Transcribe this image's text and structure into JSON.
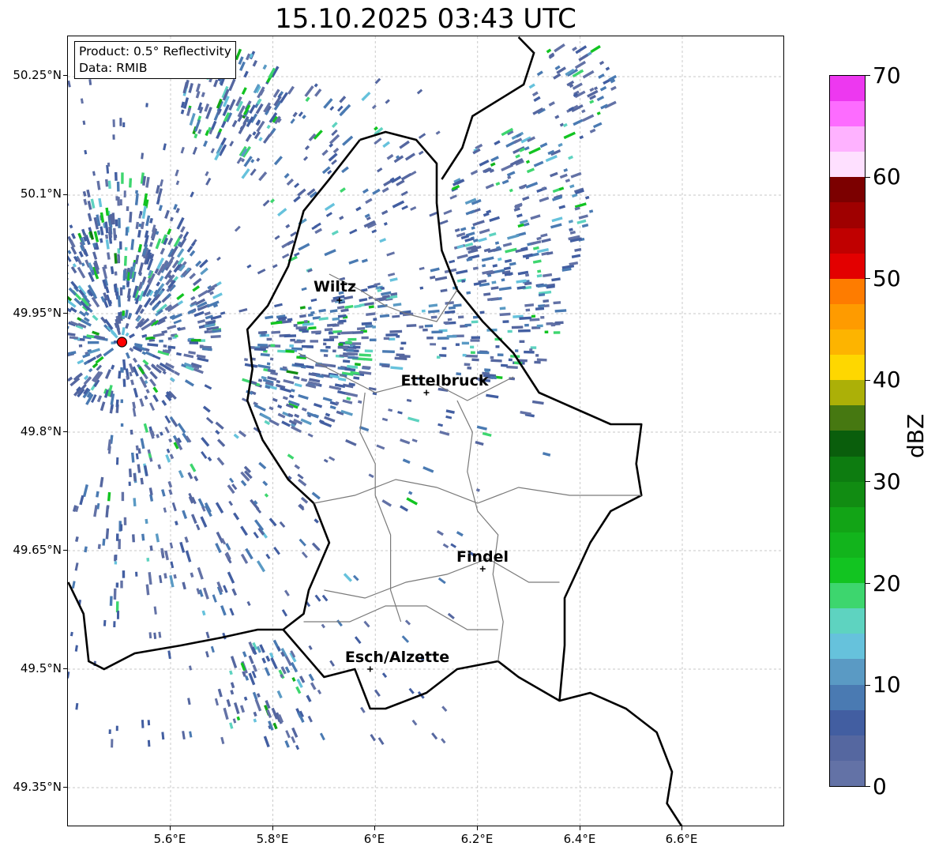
{
  "title": "15.10.2025 03:43 UTC",
  "info": {
    "product": "Product: 0.5° Reflectivity",
    "data": "Data: RMIB"
  },
  "lat_labels": [
    "50.25°N",
    "50.1°N",
    "49.95°N",
    "49.8°N",
    "49.65°N",
    "49.5°N",
    "49.35°N"
  ],
  "lon_labels": [
    "5.6°E",
    "5.8°E",
    "6°E",
    "6.2°E",
    "6.4°E",
    "6.6°E"
  ],
  "cities": [
    {
      "name": "Wiltz",
      "lat": 49.967,
      "lon": 5.93
    },
    {
      "name": "Ettelbruck",
      "lat": 49.85,
      "lon": 6.1
    },
    {
      "name": "Findel",
      "lat": 49.627,
      "lon": 6.21
    },
    {
      "name": "Esch/Alzette",
      "lat": 49.5,
      "lon": 5.99
    }
  ],
  "radar_site": {
    "lat": 49.914,
    "lon": 5.505,
    "color": "#ff0000"
  },
  "colorbar": {
    "unit": "dBZ",
    "min": 0,
    "max": 70,
    "step": 2.5,
    "tick_labels": [
      "0",
      "10",
      "20",
      "30",
      "40",
      "50",
      "60",
      "70"
    ],
    "colors": [
      "#6372a6",
      "#5567a0",
      "#425ea1",
      "#4a7ab2",
      "#5a9ac4",
      "#66c2dc",
      "#5ed3c0",
      "#3dd66e",
      "#12c421",
      "#12b41c",
      "#12a416",
      "#118c12",
      "#0d7c10",
      "#0a5e0c",
      "#467811",
      "#acb007",
      "#fed700",
      "#fdb400",
      "#fe9b00",
      "#fe7c00",
      "#e30000",
      "#c00000",
      "#9f0000",
      "#7c0000",
      "#fee0ff",
      "#feb2ff",
      "#fd6cff",
      "#ed38f0"
    ]
  },
  "map_extent": {
    "lon_min": 5.4,
    "lon_max": 6.8,
    "lat_min": 49.3,
    "lat_max": 50.3
  },
  "reflectivity_clusters": [
    {
      "lat": 49.95,
      "lon": 5.52,
      "r": 0.12,
      "n": 420,
      "max_dbz": 30
    },
    {
      "lat": 50.21,
      "lon": 5.72,
      "r": 0.07,
      "n": 120,
      "max_dbz": 28
    },
    {
      "lat": 50.02,
      "lon": 5.5,
      "r": 0.1,
      "n": 150,
      "max_dbz": 32
    },
    {
      "lat": 49.88,
      "lon": 5.85,
      "r": 0.08,
      "n": 180,
      "max_dbz": 30
    },
    {
      "lat": 49.96,
      "lon": 6.22,
      "r": 0.1,
      "n": 160,
      "max_dbz": 22
    },
    {
      "lat": 50.08,
      "lon": 6.28,
      "r": 0.1,
      "n": 140,
      "max_dbz": 26
    },
    {
      "lat": 50.23,
      "lon": 6.38,
      "r": 0.06,
      "n": 60,
      "max_dbz": 18
    },
    {
      "lat": 49.7,
      "lon": 5.6,
      "r": 0.14,
      "n": 140,
      "max_dbz": 16
    },
    {
      "lat": 49.47,
      "lon": 5.78,
      "r": 0.07,
      "n": 70,
      "max_dbz": 26
    },
    {
      "lat": 49.93,
      "lon": 5.98,
      "r": 0.06,
      "n": 80,
      "max_dbz": 28
    },
    {
      "lat": 50.12,
      "lon": 5.9,
      "r": 0.12,
      "n": 80,
      "max_dbz": 16
    },
    {
      "lat": 49.8,
      "lon": 6.05,
      "r": 0.2,
      "n": 60,
      "max_dbz": 14
    }
  ]
}
